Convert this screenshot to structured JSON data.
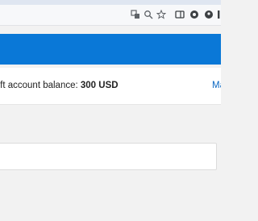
{
  "account": {
    "balance_label": "soft account balance:",
    "balance_value": "300 USD",
    "right_link_text": "Ma"
  },
  "colors": {
    "header_blue": "#0a78d7",
    "link_blue": "#0a67c2"
  },
  "icons": [
    "translate-icon",
    "zoom-icon",
    "bookmark-star-icon",
    "sidebar-icon",
    "extension-icon",
    "profile-icon"
  ]
}
